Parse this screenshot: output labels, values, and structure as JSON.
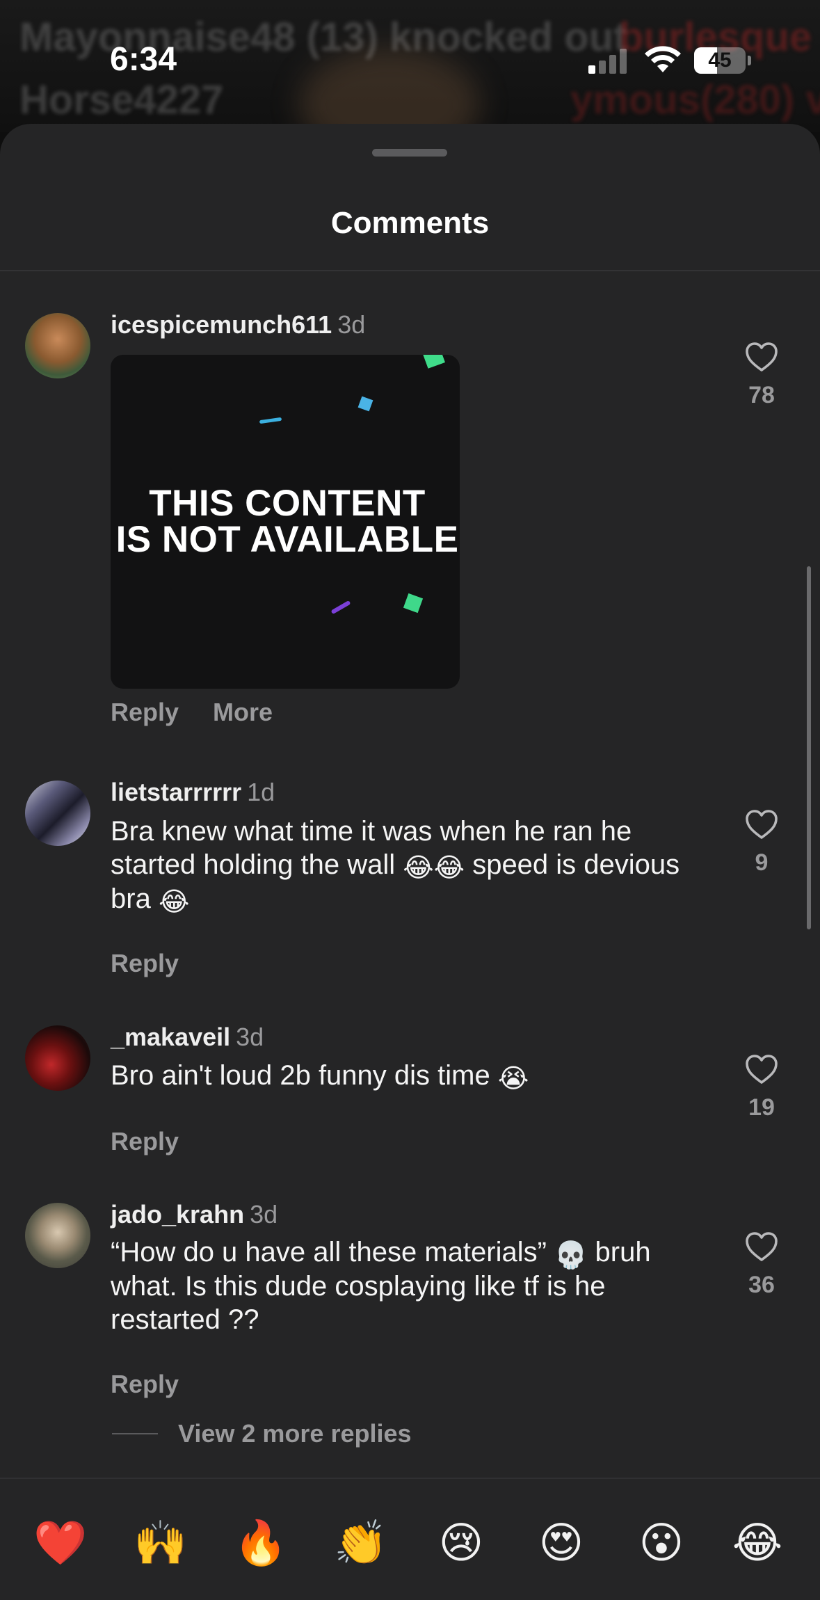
{
  "background": {
    "overlay_line1_left": "Mayonnaise48 (13) knocked out",
    "overlay_line1_right": "burlesque",
    "overlay_line2_left": "Horse4227",
    "overlay_line2_right": "ymous(280) v"
  },
  "status_bar": {
    "time": "6:34",
    "battery_level": "45",
    "signal_icon": "cellular-signal-icon",
    "wifi_icon": "wifi-icon"
  },
  "sheet": {
    "title": "Comments"
  },
  "comments": [
    {
      "username": "icespicemunch611",
      "time": "3d",
      "gif_text_line1": "THIS CONTENT",
      "gif_text_line2": "IS NOT AVAILABLE",
      "reply_label": "Reply",
      "more_label": "More",
      "likes": "78"
    },
    {
      "username": "lietstarrrrrr",
      "time": "1d",
      "text_part1": "Bra knew what time it was when he ran he started holding the wall ",
      "emoji1": "😂😂",
      "text_part2": " speed is devious bra ",
      "emoji2": "😂",
      "reply_label": "Reply",
      "likes": "9"
    },
    {
      "username": "_makaveil",
      "time": "3d",
      "text_part1": "Bro ain't loud 2b funny dis time ",
      "emoji1": "😭",
      "reply_label": "Reply",
      "likes": "19"
    },
    {
      "username": "jado_krahn",
      "time": "3d",
      "text_part1": "“How do u have all these materials” ",
      "emoji1": "💀",
      "text_part2": " bruh what. Is this dude cosplaying like tf is he restarted ??",
      "reply_label": "Reply",
      "likes": "36"
    }
  ],
  "view_more_replies": "View 2 more replies",
  "reactions": [
    "❤️",
    "🙌",
    "🔥",
    "👏",
    "😢",
    "😍",
    "😮",
    "😂"
  ]
}
